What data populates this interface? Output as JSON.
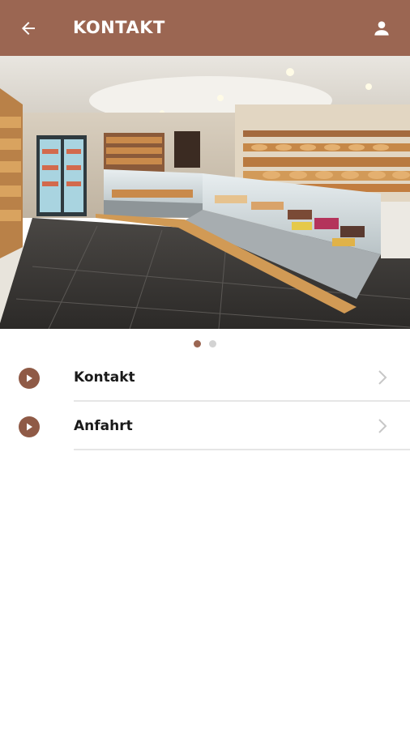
{
  "appbar": {
    "title": "KONTAKT",
    "back_icon": "arrow-left-icon",
    "profile_icon": "user-icon",
    "background": "#9b6652"
  },
  "carousel": {
    "page_count": 2,
    "active_index": 0,
    "active_color": "#9b6652",
    "inactive_color": "#d3d3d3"
  },
  "menu": {
    "items": [
      {
        "label": "Kontakt",
        "icon": "play-circle-icon"
      },
      {
        "label": "Anfahrt",
        "icon": "play-circle-icon"
      }
    ]
  }
}
